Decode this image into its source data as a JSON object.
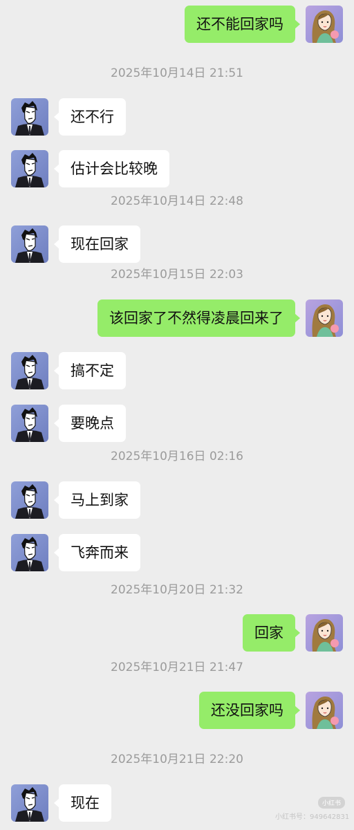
{
  "messages": [
    {
      "side": "right",
      "text": "还不能回家吗"
    },
    {
      "side": "time",
      "text": "2025年10月14日 21:51"
    },
    {
      "side": "left",
      "text": "还不行"
    },
    {
      "side": "left",
      "text": "估计会比较晚"
    },
    {
      "side": "time",
      "text": "2025年10月14日 22:48"
    },
    {
      "side": "left",
      "text": "现在回家"
    },
    {
      "side": "time",
      "text": "2025年10月15日 22:03"
    },
    {
      "side": "right",
      "text": "该回家了不然得凌晨回来了"
    },
    {
      "side": "left",
      "text": "搞不定"
    },
    {
      "side": "left",
      "text": "要晚点"
    },
    {
      "side": "time",
      "text": "2025年10月16日 02:16"
    },
    {
      "side": "left",
      "text": "马上到家"
    },
    {
      "side": "left",
      "text": "飞奔而来"
    },
    {
      "side": "time",
      "text": "2025年10月20日 21:32"
    },
    {
      "side": "right",
      "text": "回家"
    },
    {
      "side": "time",
      "text": "2025年10月21日 21:47"
    },
    {
      "side": "right",
      "text": "还没回家吗"
    },
    {
      "side": "time",
      "text": "2025年10月21日 22:20"
    },
    {
      "side": "left",
      "text": "现在"
    }
  ],
  "watermark": {
    "logo": "小红书",
    "text": "小红书号：949642831"
  },
  "colors": {
    "background": "#ededed",
    "sent_bubble": "#95ec69",
    "received_bubble": "#ffffff",
    "timestamp": "#9b9b9b"
  },
  "icons": {
    "contact_avatar": "man-in-suit-avatar",
    "self_avatar": "girl-with-long-hair-avatar"
  }
}
